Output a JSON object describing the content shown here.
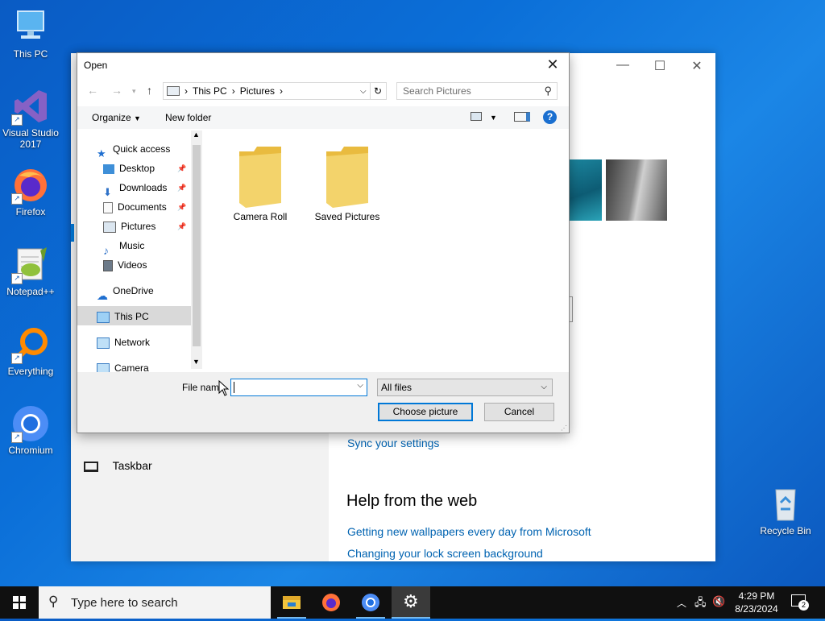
{
  "desktop": {
    "icons": [
      {
        "label": "This PC"
      },
      {
        "label": "Visual Studio 2017"
      },
      {
        "label": "Firefox"
      },
      {
        "label": "Notepad++"
      },
      {
        "label": "Everything"
      },
      {
        "label": "Chromium"
      },
      {
        "label": "Recycle Bin"
      }
    ]
  },
  "settings_window": {
    "taskbar_item": "Taskbar",
    "sync_link": "Sync your settings",
    "help_heading": "Help from the web",
    "help_links": [
      "Getting new wallpapers every day from Microsoft",
      "Changing your lock screen background"
    ]
  },
  "dialog": {
    "title": "Open",
    "breadcrumb": [
      "This PC",
      "Pictures"
    ],
    "search_placeholder": "Search Pictures",
    "toolbar": {
      "organize": "Organize",
      "new_folder": "New folder"
    },
    "nav_items": [
      {
        "label": "Quick access",
        "icon": "star-icon",
        "pinned": false
      },
      {
        "label": "Desktop",
        "icon": "desktop-icon",
        "pinned": true
      },
      {
        "label": "Downloads",
        "icon": "download-icon",
        "pinned": true
      },
      {
        "label": "Documents",
        "icon": "documents-icon",
        "pinned": true
      },
      {
        "label": "Pictures",
        "icon": "pictures-icon",
        "pinned": true
      },
      {
        "label": "Music",
        "icon": "music-icon",
        "pinned": false
      },
      {
        "label": "Videos",
        "icon": "videos-icon",
        "pinned": false
      },
      {
        "label": "OneDrive",
        "icon": "cloud-icon",
        "pinned": false
      },
      {
        "label": "This PC",
        "icon": "computer-icon",
        "pinned": false,
        "selected": true
      },
      {
        "label": "Network",
        "icon": "network-icon",
        "pinned": false
      },
      {
        "label": "Camera",
        "icon": "camera-icon",
        "pinned": false
      }
    ],
    "folders": [
      "Camera Roll",
      "Saved Pictures"
    ],
    "file_name_label": "File nam",
    "file_name_value": "",
    "file_type": "All files",
    "choose_button": "Choose picture",
    "cancel_button": "Cancel"
  },
  "taskbar": {
    "search_placeholder": "Type here to search",
    "time": "4:29 PM",
    "date": "8/23/2024",
    "notification_count": "2"
  },
  "colors": {
    "accent": "#0078d7",
    "link": "#0063b1",
    "folder": "#f3d36b"
  }
}
